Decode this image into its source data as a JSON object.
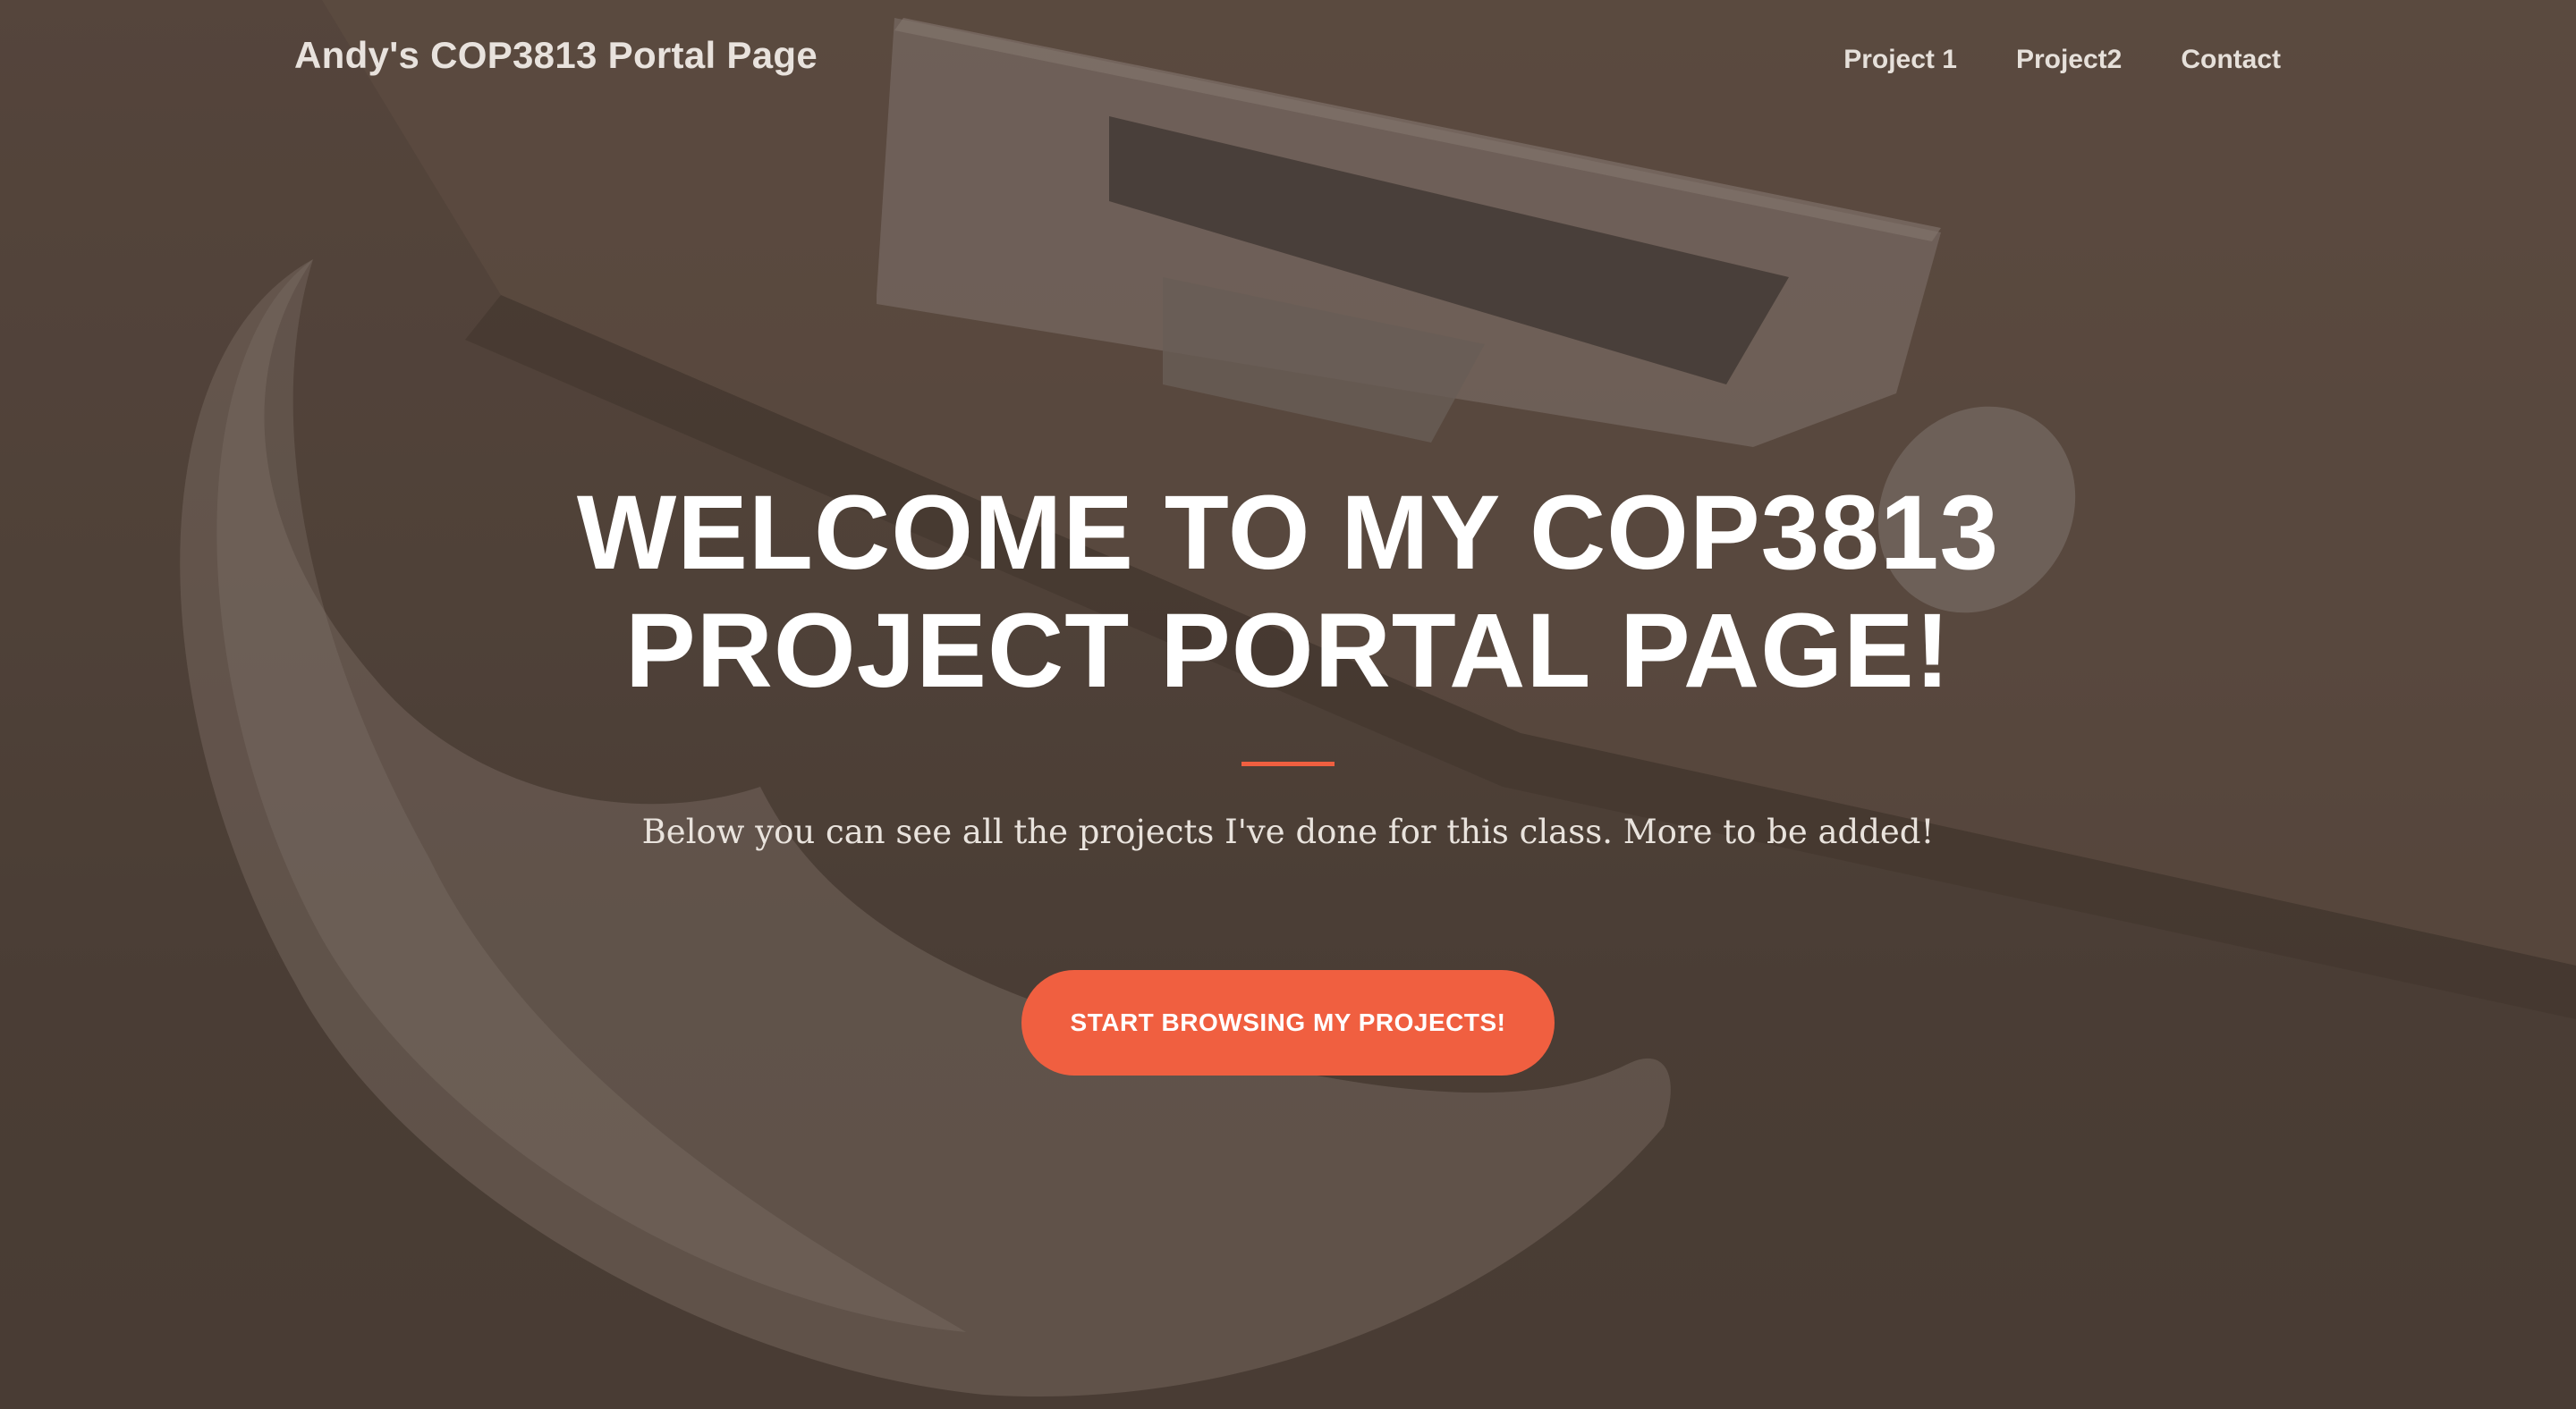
{
  "navbar": {
    "brand": "Andy's COP3813 Portal Page",
    "links": [
      {
        "label": "Project 1"
      },
      {
        "label": "Project2"
      },
      {
        "label": "Contact"
      }
    ]
  },
  "hero": {
    "title": "Welcome to my COP3813 Project Portal Page!",
    "subtitle": "Below you can see all the projects I've done for this class. More to be added!",
    "cta_label": "Start Browsing My Projects!"
  },
  "colors": {
    "accent": "#f05f40",
    "background": "#4a3d35",
    "text": "#ffffff"
  }
}
